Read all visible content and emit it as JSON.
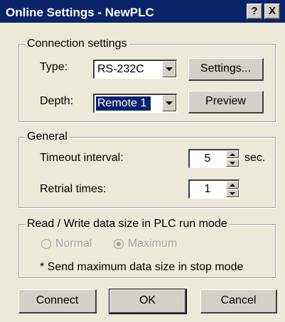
{
  "window": {
    "title": "Online Settings - NewPLC",
    "help_btn": "?",
    "close_btn": "X"
  },
  "connection": {
    "legend": "Connection settings",
    "type_label": "Type:",
    "type_value": "RS-232C",
    "settings_button": "Settings...",
    "depth_label": "Depth:",
    "depth_value": "Remote 1",
    "preview_button": "Preview"
  },
  "general": {
    "legend": "General",
    "timeout_label": "Timeout interval:",
    "timeout_value": "5",
    "timeout_unit": "sec.",
    "retrial_label": "Retrial times:",
    "retrial_value": "1"
  },
  "readwrite": {
    "legend": "Read / Write data size in PLC run mode",
    "normal_label": "Normal",
    "maximum_label": "Maximum",
    "selected": "Maximum",
    "note": "* Send maximum data size in stop mode"
  },
  "footer": {
    "connect_button": "Connect",
    "ok_button": "OK",
    "cancel_button": "Cancel"
  },
  "colors": {
    "titlebar": "#0a246a",
    "dialog_bg": "#ece9d8",
    "selection": "#0a246a"
  },
  "icons": {
    "help": "help-icon",
    "close": "close-icon",
    "dropdown": "chevron-down-icon",
    "spin_up": "spin-up-icon",
    "spin_down": "spin-down-icon"
  }
}
